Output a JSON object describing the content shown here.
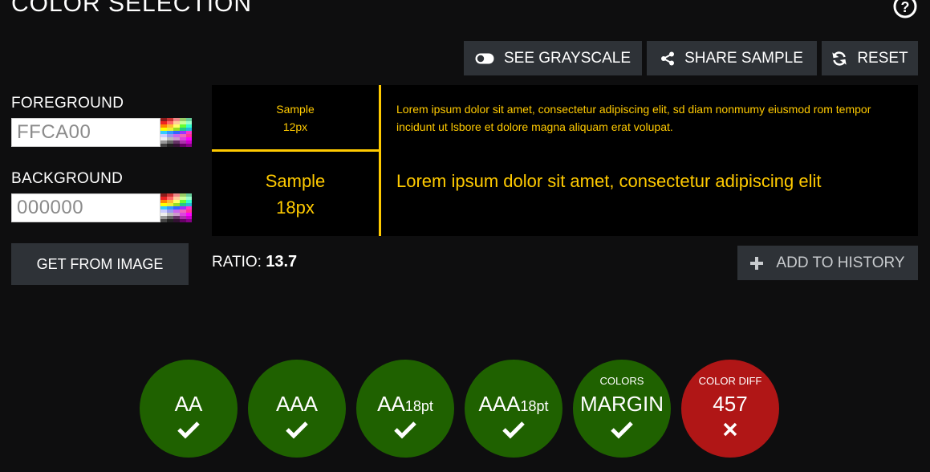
{
  "page": {
    "title": "COLOR SELECTION"
  },
  "toolbar": {
    "grayscale_label": "SEE GRAYSCALE",
    "share_label": "SHARE SAMPLE",
    "reset_label": "RESET"
  },
  "foreground": {
    "label": "FOREGROUND",
    "value": "FFCA00"
  },
  "background": {
    "label": "BACKGROUND",
    "value": "000000"
  },
  "get_from_image_label": "GET FROM IMAGE",
  "sample": {
    "small_label_line1": "Sample",
    "small_label_line2": "12px",
    "small_text": "Lorem ipsum dolor sit amet, consectetur adipiscing elit, sd diam nonmumy eiusmod rom tempor incidunt ut lsbore et dolore magna aliquam erat volupat.",
    "large_label_line1": "Sample",
    "large_label_line2": "18px",
    "large_text": "Lorem ipsum dolor sit amet, consectetur adipiscing elit"
  },
  "ratio": {
    "label": "RATIO:",
    "value": "13.7"
  },
  "history": {
    "add_label": "ADD TO HISTORY"
  },
  "results": [
    {
      "label": "AA",
      "suffix": "",
      "top": "",
      "status": "pass"
    },
    {
      "label": "AAA",
      "suffix": "",
      "top": "",
      "status": "pass"
    },
    {
      "label": "AA",
      "suffix": "18pt",
      "top": "",
      "status": "pass"
    },
    {
      "label": "AAA",
      "suffix": "18pt",
      "top": "",
      "status": "pass"
    },
    {
      "label": "MARGIN",
      "suffix": "",
      "top": "COLORS",
      "status": "pass"
    },
    {
      "label": "457",
      "suffix": "",
      "top": "COLOR DIFF",
      "status": "fail"
    }
  ],
  "colors": {
    "foreground": "#ffca00",
    "background": "#000000",
    "pass": "#1f6100",
    "fail": "#b01616",
    "button": "#2e3237"
  }
}
